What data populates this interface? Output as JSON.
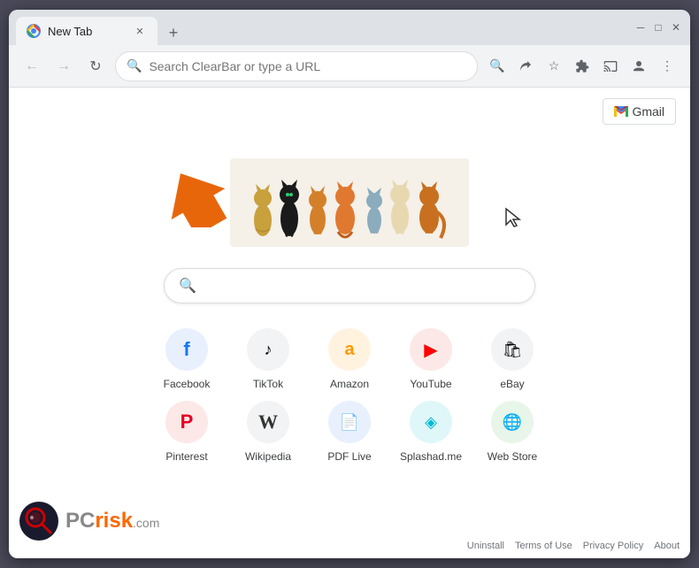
{
  "browser": {
    "tab": {
      "title": "New Tab",
      "favicon": "chrome-icon"
    },
    "new_tab_button": "+",
    "window_controls": {
      "minimize": "─",
      "maximize": "□",
      "close": "✕"
    }
  },
  "toolbar": {
    "back_button": "←",
    "forward_button": "→",
    "reload_button": "↺",
    "address_placeholder": "Search ClearBar or type a URL",
    "search_icon": "🔍",
    "share_icon": "⬆",
    "bookmark_icon": "☆",
    "extensions_icon": "🧩",
    "profile_icon": "👤",
    "menu_icon": "⋮"
  },
  "page": {
    "gmail_button": "Gmail",
    "search_placeholder": "",
    "shortcuts": [
      {
        "label": "Facebook",
        "color": "#1877f2",
        "icon": "f",
        "bg": "#e8f0fe"
      },
      {
        "label": "TikTok",
        "color": "#000",
        "icon": "♪",
        "bg": "#f1f3f4"
      },
      {
        "label": "Amazon",
        "color": "#ff9900",
        "icon": "a",
        "bg": "#fff3e0"
      },
      {
        "label": "YouTube",
        "color": "#ff0000",
        "icon": "▶",
        "bg": "#fce8e6"
      },
      {
        "label": "eBay",
        "color": "#e53238",
        "icon": "🛍",
        "bg": "#f1f3f4"
      },
      {
        "label": "Pinterest",
        "color": "#e60023",
        "icon": "P",
        "bg": "#fce8e6"
      },
      {
        "label": "Wikipedia",
        "color": "#333",
        "icon": "W",
        "bg": "#f1f3f4"
      },
      {
        "label": "PDF Live",
        "color": "#2196f3",
        "icon": "📄",
        "bg": "#e8f0fe"
      },
      {
        "label": "Splashad.me",
        "color": "#00bcd4",
        "icon": "◈",
        "bg": "#e0f7fa"
      },
      {
        "label": "Web Store",
        "color": "#4caf50",
        "icon": "🌐",
        "bg": "#e8f5e9"
      }
    ]
  },
  "footer": {
    "links": [
      "Uninstall",
      "Terms of Use",
      "Privacy Policy",
      "About"
    ]
  },
  "pcrisk": {
    "pc": "PC",
    "risk": "risk",
    "com": ".com"
  }
}
